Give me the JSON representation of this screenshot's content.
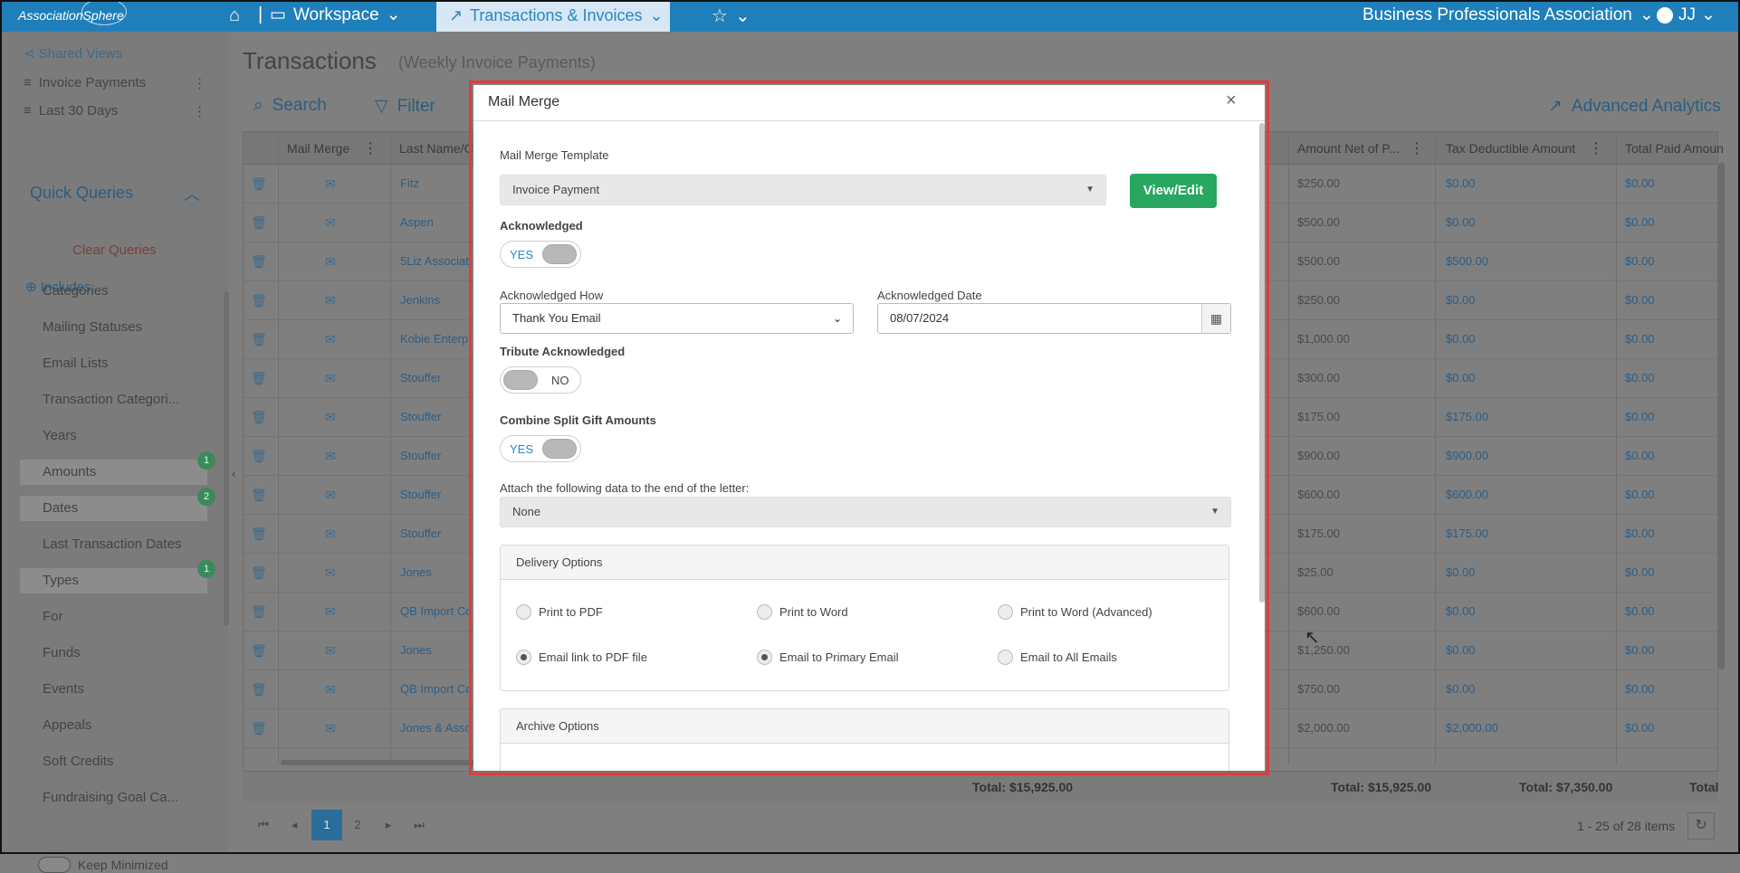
{
  "topnav": {
    "logo": "AssociationSphere",
    "workspace": "Workspace",
    "active_tab": "Transactions & Invoices",
    "association": "Business Professionals Association",
    "user": "JJ"
  },
  "sidebar": {
    "shared_views": "Shared Views",
    "views": [
      "Invoice Payments",
      "Last 30 Days"
    ],
    "quick_queries": "Quick Queries",
    "clear_queries": "Clear Queries",
    "includes": "Includes",
    "items": [
      {
        "label": "Categories",
        "badge": ""
      },
      {
        "label": "Mailing Statuses",
        "badge": ""
      },
      {
        "label": "Email Lists",
        "badge": ""
      },
      {
        "label": "Transaction Categori...",
        "badge": ""
      },
      {
        "label": "Years",
        "badge": ""
      },
      {
        "label": "Amounts",
        "badge": "1"
      },
      {
        "label": "Dates",
        "badge": "2"
      },
      {
        "label": "Last Transaction Dates",
        "badge": ""
      },
      {
        "label": "Types",
        "badge": "1"
      },
      {
        "label": "For",
        "badge": ""
      },
      {
        "label": "Funds",
        "badge": ""
      },
      {
        "label": "Events",
        "badge": ""
      },
      {
        "label": "Appeals",
        "badge": ""
      },
      {
        "label": "Soft Credits",
        "badge": ""
      },
      {
        "label": "Fundraising Goal Ca...",
        "badge": ""
      }
    ],
    "keep_minimized": "Keep Minimized"
  },
  "page": {
    "title": "Transactions",
    "subtitle": "(Weekly Invoice Payments)",
    "search": "Search",
    "filter": "Filter",
    "advanced_analytics": "Advanced Analytics"
  },
  "grid": {
    "headers": {
      "mail_merge": "Mail Merge",
      "last_name": "Last Name/C",
      "amount_net": "Amount Net of P...",
      "tax_deductible": "Tax Deductible Amount",
      "total_paid": "Total Paid Amoun"
    },
    "rows": [
      {
        "name": "Fitz",
        "amount": "$250.00",
        "tax": "$0.00",
        "paid": "$0.00"
      },
      {
        "name": "Aspen",
        "amount": "$500.00",
        "tax": "$0.00",
        "paid": "$0.00"
      },
      {
        "name": "5Liz Associat",
        "amount": "$500.00",
        "tax": "$500.00",
        "paid": "$0.00"
      },
      {
        "name": "Jenkins",
        "amount": "$250.00",
        "tax": "$0.00",
        "paid": "$0.00"
      },
      {
        "name": "Kobie Enterp",
        "amount": "$1,000.00",
        "tax": "$0.00",
        "paid": "$0.00"
      },
      {
        "name": "Stouffer",
        "amount": "$300.00",
        "tax": "$0.00",
        "paid": "$0.00"
      },
      {
        "name": "Stouffer",
        "amount": "$175.00",
        "tax": "$175.00",
        "paid": "$0.00"
      },
      {
        "name": "Stouffer",
        "amount": "$900.00",
        "tax": "$900.00",
        "paid": "$0.00"
      },
      {
        "name": "Stouffer",
        "amount": "$600.00",
        "tax": "$600.00",
        "paid": "$0.00"
      },
      {
        "name": "Stouffer",
        "amount": "$175.00",
        "tax": "$175.00",
        "paid": "$0.00"
      },
      {
        "name": "Jones",
        "amount": "$25.00",
        "tax": "$0.00",
        "paid": "$0.00"
      },
      {
        "name": "QB Import Co",
        "amount": "$600.00",
        "tax": "$0.00",
        "paid": "$0.00"
      },
      {
        "name": "Jones",
        "amount": "$1,250.00",
        "tax": "$0.00",
        "paid": "$0.00"
      },
      {
        "name": "QB Import Co",
        "amount": "$750.00",
        "tax": "$0.00",
        "paid": "$0.00"
      },
      {
        "name": "Jones & Asso",
        "amount": "$2,000.00",
        "tax": "$2,000.00",
        "paid": "$0.00"
      }
    ],
    "totals": {
      "col1": "Total: $15,925.00",
      "col2": "Total: $15,925.00",
      "col3": "Total: $7,350.00",
      "col4": "Total"
    },
    "pager": {
      "pages": [
        "1",
        "2"
      ],
      "active": "1",
      "info": "1 - 25 of 28 items"
    }
  },
  "modal": {
    "title": "Mail Merge",
    "close": "×",
    "template_label": "Mail Merge Template",
    "template_value": "Invoice Payment",
    "view_edit": "View/Edit",
    "acknowledged_label": "Acknowledged",
    "acknowledged_value": "YES",
    "ack_how_label": "Acknowledged How",
    "ack_how_value": "Thank You Email",
    "ack_date_label": "Acknowledged Date",
    "ack_date_value": "08/07/2024",
    "tribute_label": "Tribute Acknowledged",
    "tribute_value": "NO",
    "combine_label": "Combine Split Gift Amounts",
    "combine_value": "YES",
    "attach_label": "Attach the following data to the end of the letter:",
    "attach_value": "None",
    "delivery_title": "Delivery Options",
    "delivery_options": [
      {
        "label": "Print to PDF",
        "selected": false
      },
      {
        "label": "Print to Word",
        "selected": false
      },
      {
        "label": "Print to Word (Advanced)",
        "selected": false
      },
      {
        "label": "Email link to PDF file",
        "selected": true
      },
      {
        "label": "Email to Primary Email",
        "selected": true
      },
      {
        "label": "Email to All Emails",
        "selected": false
      }
    ],
    "archive_title": "Archive Options"
  },
  "colors": {
    "nav": "#1f7fba",
    "accent_green": "#27a760",
    "highlight_red": "#e03b3b",
    "link_blue": "#2b87c4"
  }
}
